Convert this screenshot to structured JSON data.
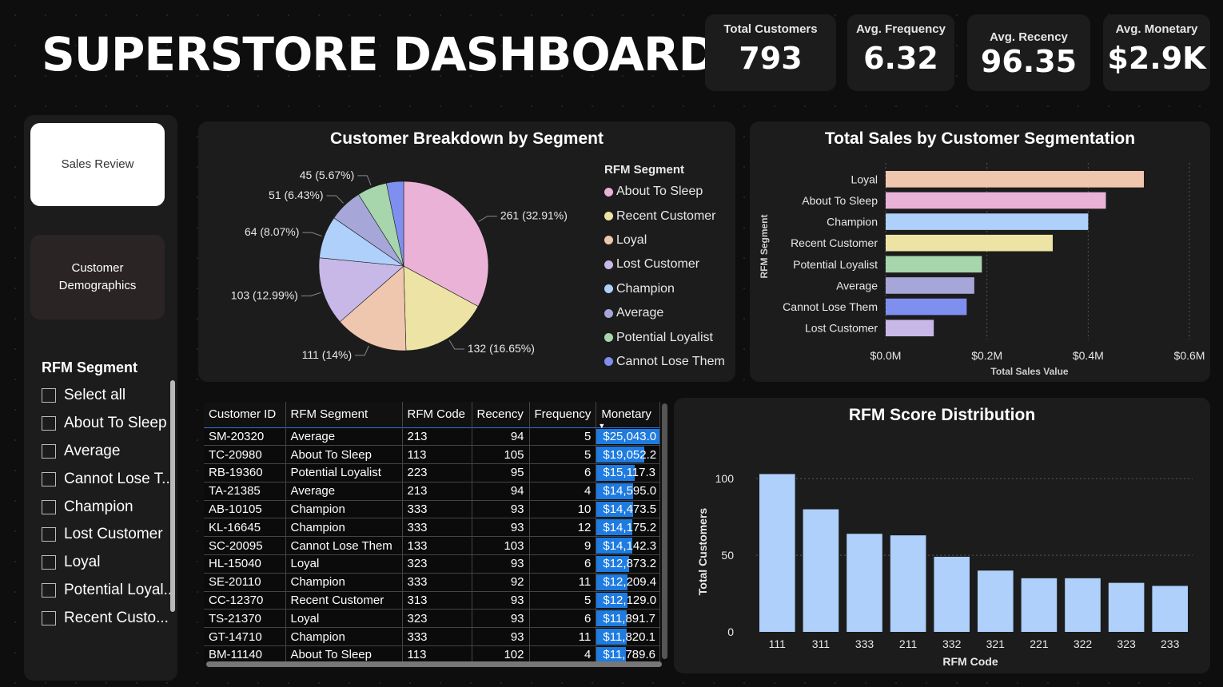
{
  "header": {
    "title": "SUPERSTORE DASHBOARD"
  },
  "kpis": [
    {
      "label": "Total Customers",
      "value": "793"
    },
    {
      "label": "Avg. Frequency",
      "value": "6.32"
    },
    {
      "label": "Avg. Recency",
      "value": "96.35"
    },
    {
      "label": "Avg. Monetary",
      "value": "$2.9K"
    }
  ],
  "nav": {
    "sales_review": "Sales Review",
    "customer_demographics": "Customer Demographics"
  },
  "slicer": {
    "title": "RFM Segment",
    "items": [
      "Select all",
      "About To Sleep",
      "Average",
      "Cannot Lose T...",
      "Champion",
      "Lost Customer",
      "Loyal",
      "Potential Loyal...",
      "Recent Custo..."
    ]
  },
  "colors": {
    "About To Sleep": "#ebb2d8",
    "Recent Customer": "#ede3a4",
    "Loyal": "#efc7ae",
    "Lost Customer": "#c8b8e8",
    "Champion": "#aed0fa",
    "Average": "#a6a6d9",
    "Potential Loyalist": "#a7d6ad",
    "Cannot Lose Them": "#7f8ff0",
    "rfm_bar": "#aed0fa",
    "monetary_bar": "#1e7be0"
  },
  "chart_data": [
    {
      "type": "pie",
      "title": "Customer Breakdown by Segment",
      "legend_title": "RFM Segment",
      "legend_position": "right",
      "slices": [
        {
          "label": "About To Sleep",
          "value": 261,
          "text": "261 (32.91%)"
        },
        {
          "label": "Recent Customer",
          "value": 132,
          "text": "132 (16.65%)"
        },
        {
          "label": "Loyal",
          "value": 111,
          "text": "111 (14%)"
        },
        {
          "label": "Lost Customer",
          "value": 103,
          "text": "103 (12.99%)"
        },
        {
          "label": "Champion",
          "value": 64,
          "text": "64 (8.07%)"
        },
        {
          "label": "Average",
          "value": 51,
          "text": "51 (6.43%)"
        },
        {
          "label": "Potential Loyalist",
          "value": 45,
          "text": "45 (5.67%)"
        },
        {
          "label": "Cannot Lose Them",
          "value": 26,
          "text": ""
        }
      ]
    },
    {
      "type": "bar",
      "orientation": "horizontal",
      "title": "Total Sales by Customer Segmentation",
      "categories": [
        "Loyal",
        "About To Sleep",
        "Champion",
        "Recent Customer",
        "Potential Loyalist",
        "Average",
        "Cannot Lose Them",
        "Lost Customer"
      ],
      "values": [
        0.51,
        0.435,
        0.4,
        0.33,
        0.19,
        0.175,
        0.16,
        0.095
      ],
      "xlabel": "Total Sales Value",
      "ylabel": "RFM Segment",
      "xlim": [
        0,
        0.6
      ],
      "xticks": [
        "$0.0M",
        "$0.2M",
        "$0.4M",
        "$0.6M"
      ],
      "grid": true
    },
    {
      "type": "bar",
      "title": "RFM Score Distribution",
      "categories": [
        "111",
        "311",
        "333",
        "211",
        "332",
        "321",
        "221",
        "322",
        "323",
        "233"
      ],
      "values": [
        103,
        80,
        64,
        63,
        49,
        40,
        35,
        35,
        32,
        30
      ],
      "xlabel": "RFM Code",
      "ylabel": "Total Customers",
      "ylim": [
        0,
        110
      ],
      "yticks": [
        "0",
        "50",
        "100"
      ],
      "grid": true
    }
  ],
  "table": {
    "columns": [
      "Customer ID",
      "RFM Segment",
      "RFM Code",
      "Recency",
      "Frequency",
      "Monetary"
    ],
    "rows": [
      [
        "SM-20320",
        "Average",
        "213",
        "94",
        "5",
        "$25,043.0"
      ],
      [
        "TC-20980",
        "About To Sleep",
        "113",
        "105",
        "5",
        "$19,052.2"
      ],
      [
        "RB-19360",
        "Potential Loyalist",
        "223",
        "95",
        "6",
        "$15,117.3"
      ],
      [
        "TA-21385",
        "Average",
        "213",
        "94",
        "4",
        "$14,595.0"
      ],
      [
        "AB-10105",
        "Champion",
        "333",
        "93",
        "10",
        "$14,473.5"
      ],
      [
        "KL-16645",
        "Champion",
        "333",
        "93",
        "12",
        "$14,175.2"
      ],
      [
        "SC-20095",
        "Cannot Lose Them",
        "133",
        "103",
        "9",
        "$14,142.3"
      ],
      [
        "HL-15040",
        "Loyal",
        "323",
        "93",
        "6",
        "$12,873.2"
      ],
      [
        "SE-20110",
        "Champion",
        "333",
        "92",
        "11",
        "$12,209.4"
      ],
      [
        "CC-12370",
        "Recent Customer",
        "313",
        "93",
        "5",
        "$12,129.0"
      ],
      [
        "TS-21370",
        "Loyal",
        "323",
        "93",
        "6",
        "$11,891.7"
      ],
      [
        "GT-14710",
        "Champion",
        "333",
        "93",
        "11",
        "$11,820.1"
      ],
      [
        "BM-11140",
        "About To Sleep",
        "113",
        "102",
        "4",
        "$11,789.6"
      ]
    ],
    "monetary_values": [
      25043,
      19052,
      15117,
      14595,
      14473,
      14175,
      14142,
      12873,
      12209,
      12129,
      11891,
      11820,
      11789
    ]
  }
}
